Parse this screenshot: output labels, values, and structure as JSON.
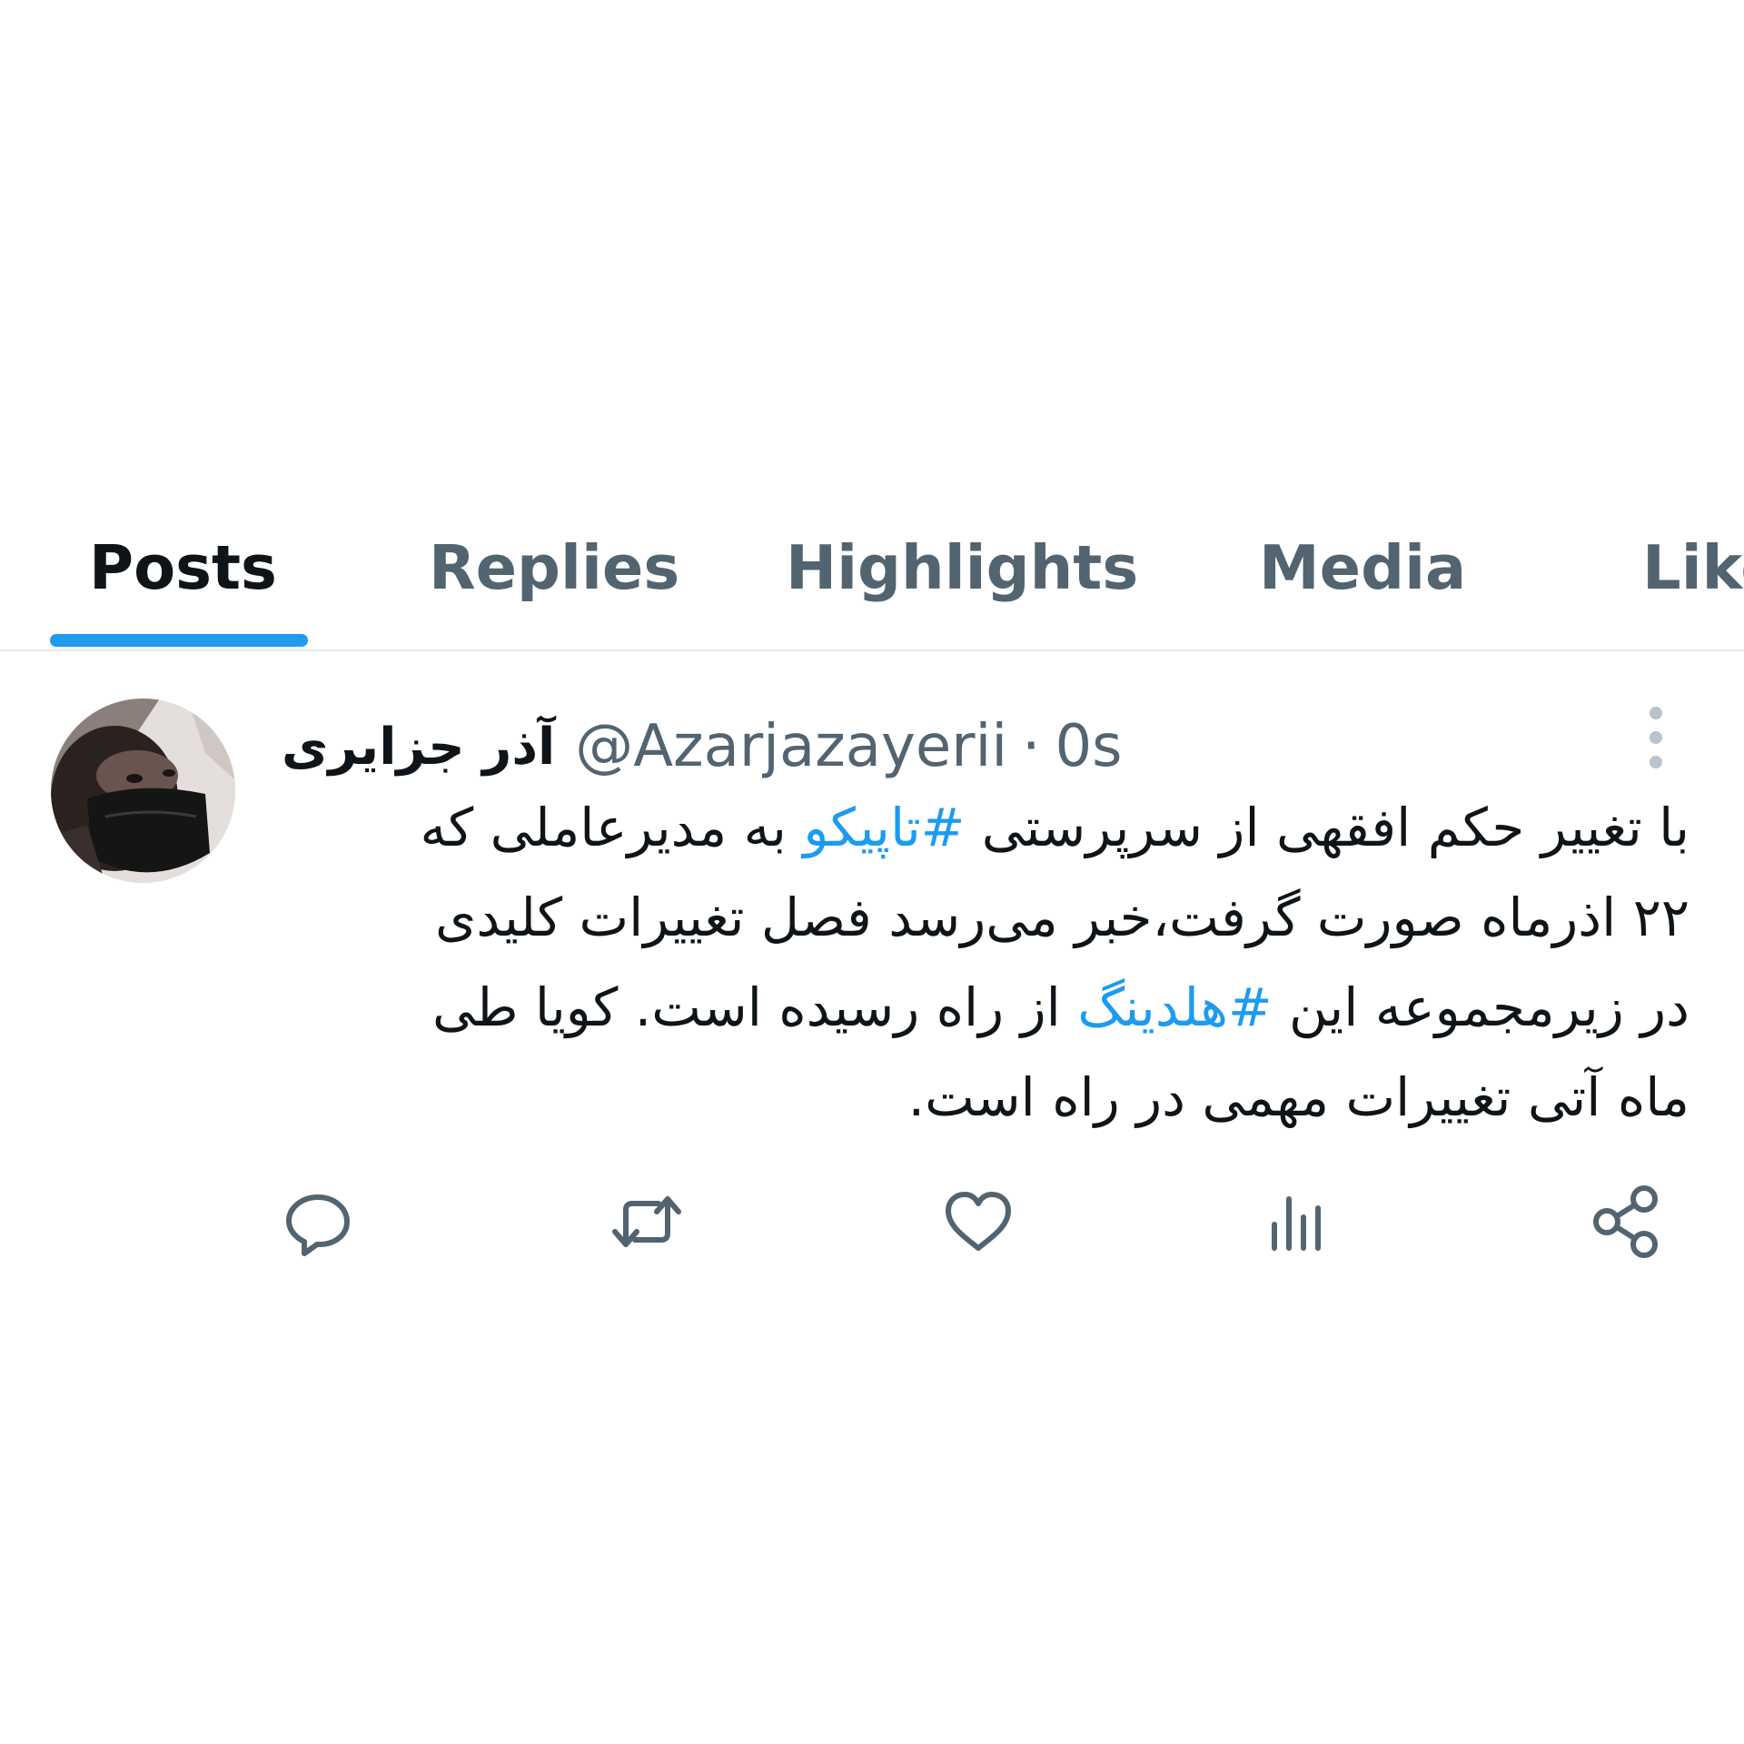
{
  "tabs": [
    {
      "label": "Posts",
      "active": true
    },
    {
      "label": "Replies",
      "active": false
    },
    {
      "label": "Highlights",
      "active": false
    },
    {
      "label": "Media",
      "active": false
    },
    {
      "label": "Likes",
      "active": false
    }
  ],
  "post": {
    "display_name": "آذر جزایری",
    "handle": "@Azarjazayerii",
    "separator": "·",
    "timestamp": "0s",
    "text_lines": [
      [
        "با تغییر حکم افقهی از سرپرستی ",
        "#تاپیکو",
        " به مدیرعاملی که"
      ],
      [
        "۲۲ اذرماه صورت گرفت،خبر می‌رسد فصل تغییرات کلیدی"
      ],
      [
        "در زیرمجموعه این ",
        "#هلدینگ",
        " از راه رسیده است.  کویا طی"
      ],
      [
        "ماه آتی تغییرات مهمی در راه است."
      ]
    ],
    "hashtags": [
      "#تاپیکو",
      "#هلدینگ"
    ]
  },
  "actions": {
    "icons": [
      "reply-icon",
      "repost-icon",
      "like-icon",
      "views-icon",
      "share-icon"
    ]
  },
  "colors": {
    "accent": "#1d9bf0",
    "text_primary": "#0f1419",
    "text_secondary": "#536471",
    "divider": "#e6ecf0"
  }
}
